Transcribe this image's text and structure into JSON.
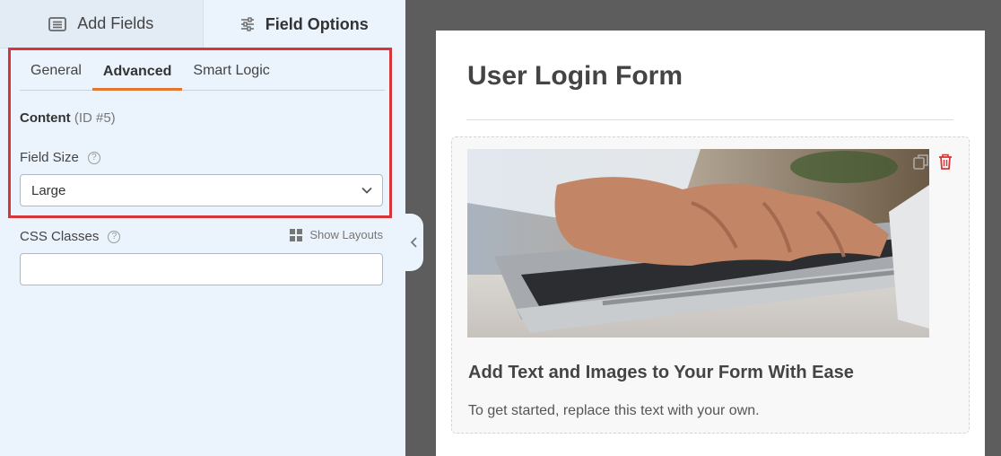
{
  "top_tabs": [
    {
      "label": "Add Fields",
      "icon": "list-icon",
      "active": false
    },
    {
      "label": "Field Options",
      "icon": "sliders-icon",
      "active": true
    }
  ],
  "sub_tabs": [
    {
      "label": "General",
      "active": false
    },
    {
      "label": "Advanced",
      "active": true
    },
    {
      "label": "Smart Logic",
      "active": false
    }
  ],
  "content": {
    "title": "Content",
    "id": "(ID #5)"
  },
  "field_size": {
    "label": "Field Size",
    "value": "Large"
  },
  "css_classes": {
    "label": "CSS Classes",
    "value": "",
    "show_layouts": "Show Layouts"
  },
  "form": {
    "title": "User Login Form",
    "field_heading": "Add Text and Images to Your Form With Ease",
    "field_description": "To get started, replace this text with your own."
  },
  "colors": {
    "accent": "#e27730",
    "highlight": "#d63638",
    "panel": "#ebf3fc"
  }
}
